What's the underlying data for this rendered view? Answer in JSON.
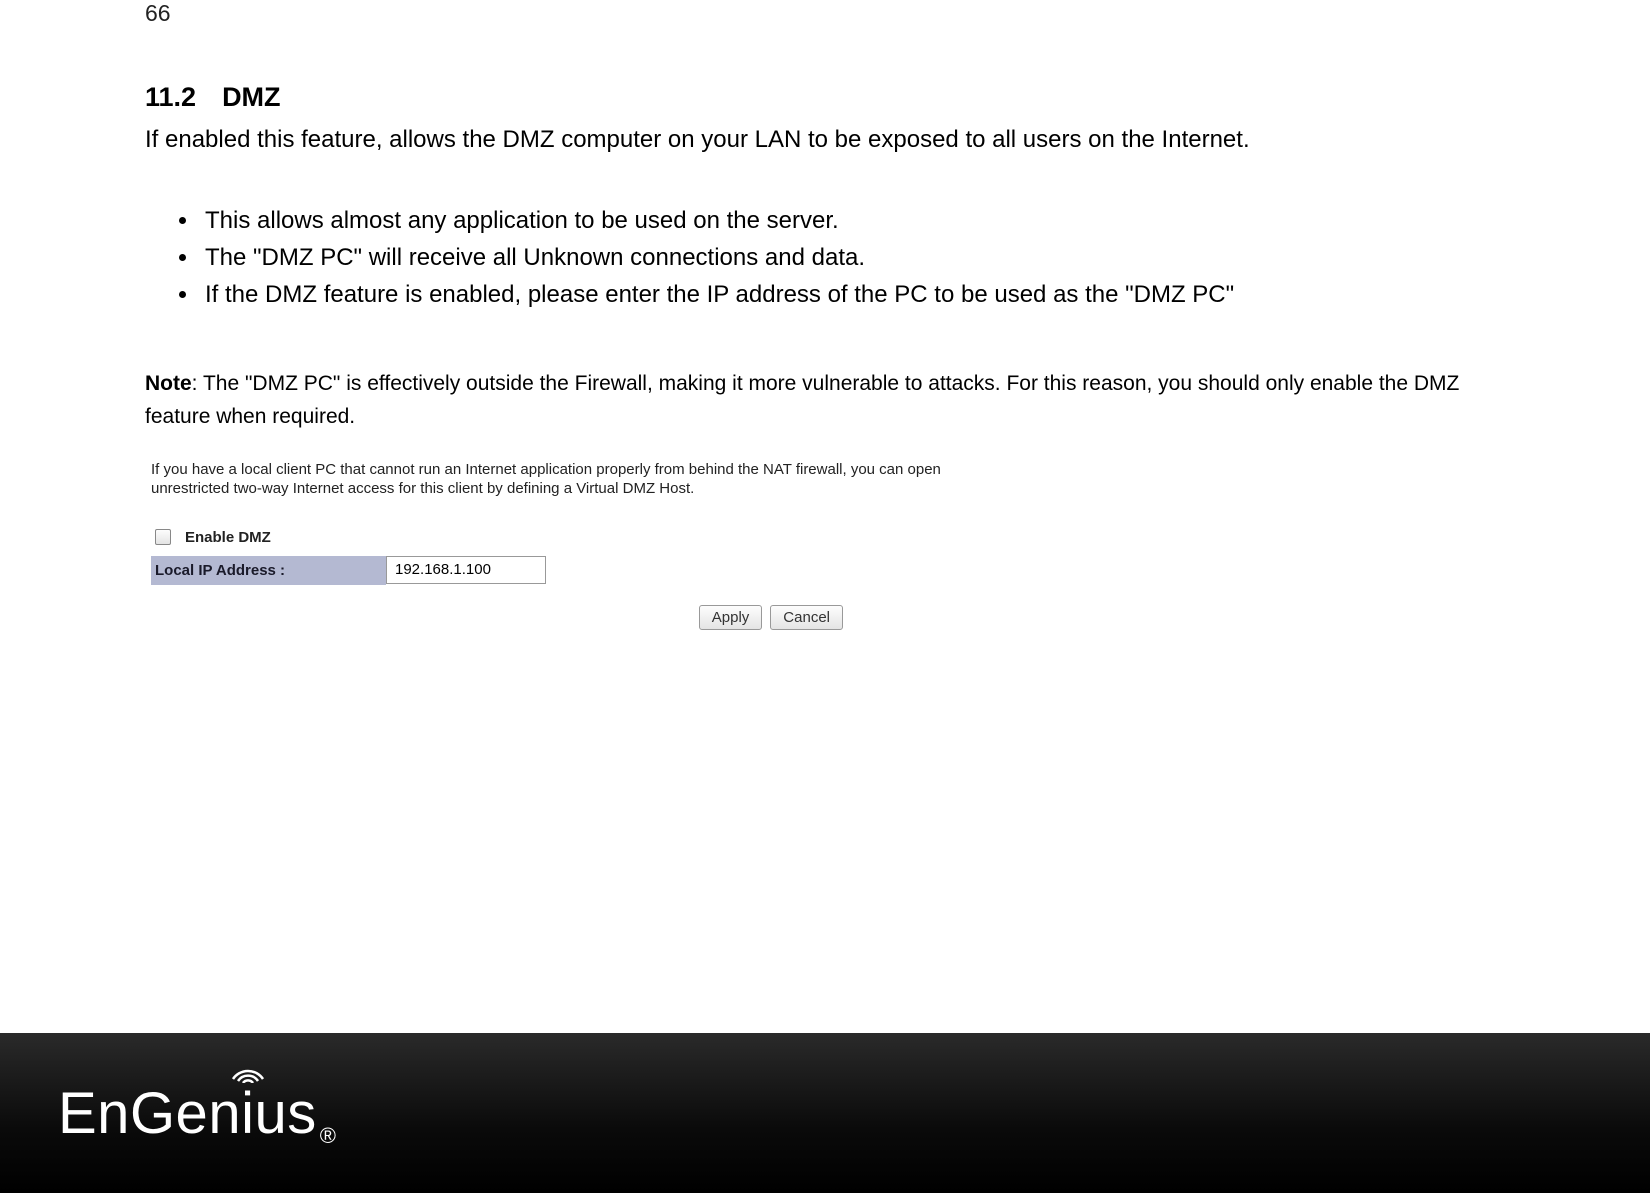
{
  "page_number": "66",
  "section": {
    "number": "11.2",
    "title": "DMZ",
    "intro": "If enabled this feature, allows the DMZ computer on your LAN to be exposed to all users on the Internet.",
    "bullets": [
      "This allows almost any application to be used on the server.",
      "The \"DMZ PC\" will receive all Unknown connections and data.",
      "If the DMZ feature is enabled, please enter the IP address of the PC to be used as the \"DMZ PC\""
    ],
    "note_prefix": "Note",
    "note_body": ": The \"DMZ PC\" is effectively outside the Firewall, making it more vulnerable to attacks. For this reason, you should only enable the DMZ feature when required."
  },
  "ui": {
    "description": "If you have a local client PC that cannot run an Internet application properly from behind the NAT firewall, you can open unrestricted two-way Internet access for this client by defining a Virtual DMZ Host.",
    "enable_label": "Enable DMZ",
    "ip_label": "Local IP Address :",
    "ip_value": "192.168.1.100",
    "apply_label": "Apply",
    "cancel_label": "Cancel"
  },
  "footer": {
    "brand_part1": "EnGen",
    "brand_i": "i",
    "brand_part2": "us",
    "reg": "®"
  }
}
